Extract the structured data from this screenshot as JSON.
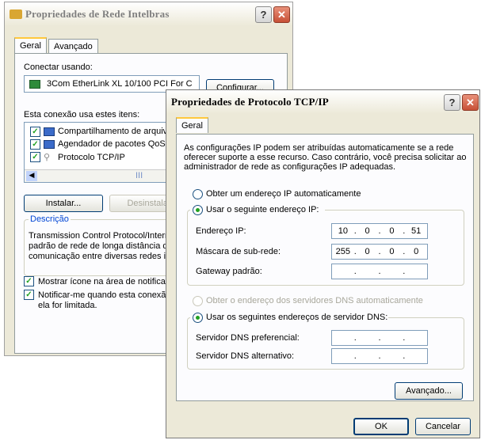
{
  "back_window": {
    "title": "Propriedades de Rede Intelbras",
    "tabs": [
      "Geral",
      "Avançado"
    ],
    "connect_using_label": "Conectar usando:",
    "adapter_name": "3Com EtherLink XL 10/100 PCI For C",
    "configure_button": "Configurar...",
    "items_label": "Esta conexão usa estes itens:",
    "items": [
      {
        "label": "Compartilhamento de arquivos",
        "checked": true
      },
      {
        "label": "Agendador de pacotes QoS",
        "checked": true
      },
      {
        "label": "Protocolo TCP/IP",
        "checked": true
      }
    ],
    "install_button": "Instalar...",
    "uninstall_button": "Desinstalar",
    "description_title": "Descrição",
    "description_text": [
      "Transmission Control Protocol/Interne",
      "padrão de rede de longa distância q",
      "comunicação entre diversas redes in"
    ],
    "show_icon_label": "Mostrar ícone na área de notificação",
    "notify_label_line1": "Notificar-me quando esta conexão",
    "notify_label_line2": "ela for limitada.",
    "scroll_mark": "III"
  },
  "front_window": {
    "title": "Propriedades de Protocolo TCP/IP",
    "tab": "Geral",
    "intro": [
      "As configurações IP podem ser atribuídas automaticamente se a rede",
      "oferecer suporte a esse recurso. Caso contrário, você precisa solicitar ao",
      "administrador de rede as configurações IP adequadas."
    ],
    "radio_auto_ip": "Obter um endereço IP automaticamente",
    "radio_manual_ip": "Usar o seguinte endereço IP:",
    "ip_label": "Endereço IP:",
    "ip_value": [
      "10",
      "0",
      "0",
      "51"
    ],
    "mask_label": "Máscara de sub-rede:",
    "mask_value": [
      "255",
      "0",
      "0",
      "0"
    ],
    "gateway_label": "Gateway padrão:",
    "radio_auto_dns": "Obter o endereço dos servidores DNS automaticamente",
    "radio_manual_dns": "Usar os seguintes endereços de servidor DNS:",
    "dns_pref_label": "Servidor DNS preferencial:",
    "dns_alt_label": "Servidor DNS alternativo:",
    "advanced_button": "Avançado...",
    "ok_button": "OK",
    "cancel_button": "Cancelar"
  },
  "colors": {
    "window_bg": "#ece9d8",
    "tab_accent": "#ffc83c",
    "close_red": "#c75036",
    "check_green": "#21a121"
  }
}
